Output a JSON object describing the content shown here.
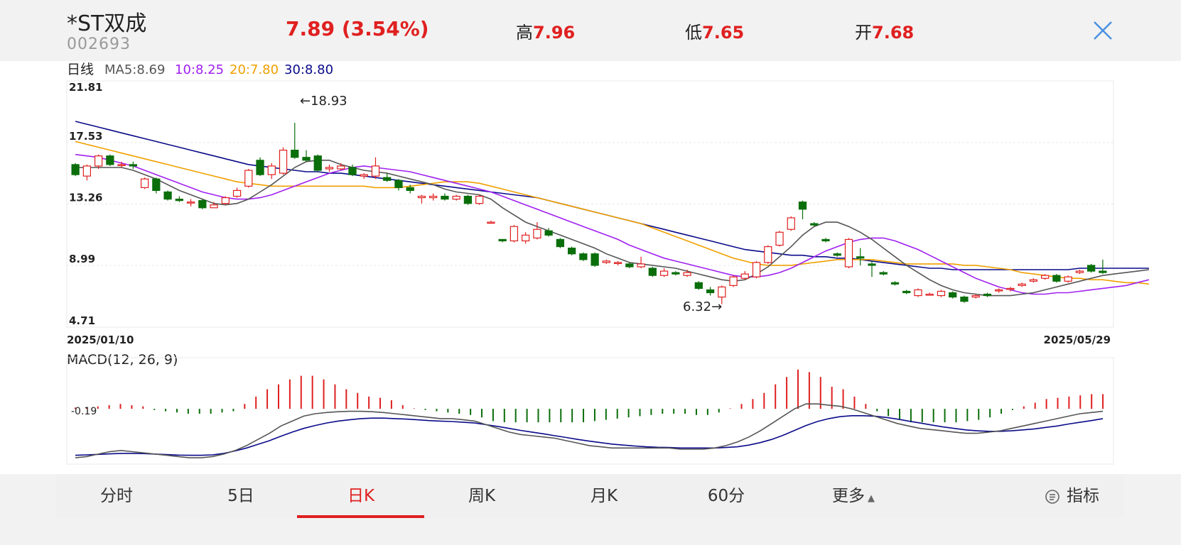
{
  "header": {
    "name": "*ST双成",
    "code": "002693",
    "price": "7.89",
    "change": "(3.54%)",
    "high_label": "高",
    "high": "7.96",
    "low_label": "低",
    "low": "7.65",
    "open_label": "开",
    "open": "7.68"
  },
  "colors": {
    "up": "#e02020",
    "down": "#0a6e0a",
    "ma5": "#555555",
    "ma10": "#a020f0",
    "ma20": "#f0a000",
    "ma30": "#0a0a8a",
    "dif": "#555555",
    "dea": "#0a0a8a"
  },
  "legend": {
    "period": "日线",
    "ma5": "MA5:8.69",
    "ma10": "10:8.25",
    "ma20": "20:7.80",
    "ma30": "30:8.80"
  },
  "tabs": [
    {
      "label": "分时"
    },
    {
      "label": "5日"
    },
    {
      "label": "日K"
    },
    {
      "label": "周K"
    },
    {
      "label": "月K"
    },
    {
      "label": "60分"
    },
    {
      "label": "更多"
    }
  ],
  "indicator_label": "指标",
  "chart_data": {
    "type": "candlestick",
    "start_date": "2025/01/10",
    "end_date": "2025/05/29",
    "y_ticks": [
      "21.81",
      "17.53",
      "13.26",
      "8.99",
      "4.71"
    ],
    "ylim": [
      4.71,
      21.81
    ],
    "max_label": "←18.93",
    "min_label": "6.32→",
    "candles": [
      [
        16.0,
        15.3,
        16.1,
        15.2
      ],
      [
        15.2,
        15.9,
        16.0,
        14.9
      ],
      [
        15.9,
        16.6,
        16.7,
        15.7
      ],
      [
        16.6,
        16.0,
        16.7,
        15.9
      ],
      [
        16.0,
        16.0,
        16.2,
        15.8
      ],
      [
        16.0,
        15.9,
        16.2,
        15.7
      ],
      [
        14.4,
        15.0,
        15.1,
        14.3
      ],
      [
        15.0,
        14.2,
        15.1,
        14.0
      ],
      [
        14.1,
        13.6,
        14.2,
        13.5
      ],
      [
        13.6,
        13.5,
        13.8,
        13.4
      ],
      [
        13.4,
        13.4,
        13.6,
        13.1
      ],
      [
        13.5,
        13.0,
        13.6,
        12.9
      ],
      [
        13.0,
        13.2,
        13.4,
        13.0
      ],
      [
        13.3,
        13.7,
        13.8,
        13.2
      ],
      [
        13.8,
        14.2,
        14.4,
        13.7
      ],
      [
        14.5,
        15.6,
        15.7,
        14.4
      ],
      [
        16.3,
        15.3,
        16.5,
        15.2
      ],
      [
        15.3,
        15.9,
        16.1,
        15.0
      ],
      [
        15.4,
        17.0,
        17.2,
        15.3
      ],
      [
        17.0,
        16.5,
        18.9,
        16.4
      ],
      [
        16.5,
        16.3,
        17.0,
        16.2
      ],
      [
        16.6,
        15.6,
        16.7,
        15.5
      ],
      [
        15.7,
        15.8,
        16.0,
        15.5
      ],
      [
        15.7,
        15.9,
        16.1,
        15.6
      ],
      [
        15.8,
        15.3,
        16.0,
        15.2
      ],
      [
        15.2,
        15.3,
        15.4,
        15.0
      ],
      [
        15.2,
        15.9,
        16.5,
        15.0
      ],
      [
        15.1,
        14.9,
        15.4,
        14.8
      ],
      [
        14.9,
        14.4,
        15.0,
        14.2
      ],
      [
        14.4,
        14.2,
        14.6,
        14.0
      ],
      [
        13.7,
        13.8,
        13.9,
        13.3
      ],
      [
        13.7,
        13.8,
        14.0,
        13.5
      ],
      [
        13.8,
        13.6,
        14.0,
        13.5
      ],
      [
        13.6,
        13.8,
        13.9,
        13.5
      ],
      [
        13.8,
        13.3,
        13.9,
        13.2
      ],
      [
        13.3,
        13.8,
        13.9,
        13.2
      ],
      [
        12.0,
        12.0,
        12.1,
        11.9
      ],
      [
        10.8,
        10.7,
        10.8,
        10.6
      ],
      [
        10.7,
        11.7,
        11.8,
        10.6
      ],
      [
        10.7,
        11.1,
        11.3,
        10.5
      ],
      [
        10.9,
        11.5,
        12.0,
        10.8
      ],
      [
        11.4,
        11.1,
        11.6,
        11.0
      ],
      [
        10.8,
        10.3,
        10.9,
        10.2
      ],
      [
        10.2,
        9.8,
        10.3,
        9.7
      ],
      [
        9.8,
        9.4,
        9.9,
        9.3
      ],
      [
        9.8,
        9.0,
        9.9,
        8.9
      ],
      [
        9.2,
        9.3,
        9.4,
        9.1
      ],
      [
        9.2,
        9.2,
        9.3,
        9.0
      ],
      [
        9.1,
        8.9,
        9.2,
        8.8
      ],
      [
        8.9,
        9.1,
        9.6,
        8.8
      ],
      [
        8.8,
        8.3,
        8.9,
        8.2
      ],
      [
        8.3,
        8.6,
        8.8,
        8.2
      ],
      [
        8.5,
        8.4,
        8.6,
        8.3
      ],
      [
        8.3,
        8.5,
        8.7,
        8.2
      ],
      [
        7.8,
        7.4,
        7.9,
        7.3
      ],
      [
        7.3,
        7.1,
        7.5,
        6.9
      ],
      [
        6.8,
        7.5,
        7.6,
        6.3
      ],
      [
        7.6,
        8.2,
        8.3,
        7.5
      ],
      [
        8.1,
        8.4,
        8.6,
        8.0
      ],
      [
        8.2,
        9.2,
        9.3,
        8.1
      ],
      [
        9.2,
        10.3,
        10.4,
        9.1
      ],
      [
        10.4,
        11.3,
        11.4,
        10.3
      ],
      [
        11.5,
        12.3,
        12.4,
        11.4
      ],
      [
        13.4,
        12.9,
        13.5,
        12.2
      ],
      [
        11.9,
        11.8,
        12.0,
        11.7
      ],
      [
        10.8,
        10.7,
        10.9,
        10.6
      ],
      [
        9.8,
        9.7,
        9.9,
        9.6
      ],
      [
        8.9,
        10.8,
        10.9,
        8.8
      ],
      [
        9.6,
        9.5,
        10.2,
        9.0
      ],
      [
        9.1,
        9.0,
        9.3,
        8.2
      ],
      [
        8.5,
        8.4,
        8.6,
        8.3
      ],
      [
        7.8,
        7.7,
        7.9,
        7.6
      ],
      [
        7.2,
        7.1,
        7.3,
        7.0
      ],
      [
        6.9,
        7.3,
        7.4,
        6.8
      ],
      [
        7.0,
        7.0,
        7.1,
        6.9
      ],
      [
        6.9,
        7.2,
        7.3,
        6.8
      ],
      [
        7.1,
        6.8,
        7.2,
        6.7
      ],
      [
        6.8,
        6.5,
        6.9,
        6.4
      ],
      [
        6.8,
        6.9,
        7.0,
        6.7
      ],
      [
        7.0,
        6.9,
        7.1,
        6.8
      ],
      [
        7.3,
        7.3,
        7.4,
        7.1
      ],
      [
        7.4,
        7.4,
        7.5,
        7.2
      ],
      [
        7.6,
        7.7,
        7.8,
        7.5
      ],
      [
        7.9,
        8.0,
        8.1,
        7.8
      ],
      [
        8.1,
        8.3,
        8.4,
        8.0
      ],
      [
        8.3,
        7.9,
        8.4,
        7.8
      ],
      [
        7.9,
        8.2,
        8.3,
        7.8
      ],
      [
        8.5,
        8.6,
        8.7,
        8.4
      ],
      [
        9.0,
        8.6,
        9.1,
        8.5
      ],
      [
        8.6,
        8.5,
        9.4,
        8.4
      ]
    ],
    "ma5": [
      15.8,
      15.8,
      15.8,
      15.8,
      15.8,
      15.6,
      15.3,
      15.0,
      14.6,
      14.2,
      13.9,
      13.6,
      13.3,
      13.2,
      13.3,
      13.6,
      14.1,
      14.6,
      15.2,
      15.8,
      16.2,
      16.3,
      16.3,
      16.0,
      15.8,
      15.6,
      15.5,
      15.4,
      15.2,
      15.0,
      14.8,
      14.6,
      14.3,
      14.1,
      14.0,
      13.9,
      13.6,
      13.0,
      12.5,
      12.0,
      11.7,
      11.4,
      11.1,
      10.8,
      10.5,
      10.2,
      9.8,
      9.5,
      9.2,
      9.1,
      9.0,
      8.9,
      8.8,
      8.6,
      8.4,
      8.2,
      8.0,
      7.9,
      8.0,
      8.4,
      8.9,
      9.6,
      10.3,
      11.1,
      11.7,
      12.0,
      12.0,
      11.7,
      11.3,
      10.8,
      10.2,
      9.6,
      9.0,
      8.5,
      8.0,
      7.6,
      7.3,
      7.1,
      7.0,
      6.9,
      6.9,
      6.9,
      7.0,
      7.1,
      7.3,
      7.5,
      7.7,
      7.9,
      8.1,
      8.3,
      8.4,
      8.5,
      8.6,
      8.7
    ],
    "ma10": [
      16.7,
      16.6,
      16.5,
      16.3,
      16.1,
      15.9,
      15.6,
      15.3,
      15.0,
      14.7,
      14.4,
      14.1,
      13.9,
      13.7,
      13.6,
      13.6,
      13.7,
      13.9,
      14.2,
      14.5,
      14.8,
      15.1,
      15.4,
      15.6,
      15.8,
      15.9,
      15.8,
      15.7,
      15.6,
      15.5,
      15.3,
      15.1,
      14.9,
      14.7,
      14.5,
      14.3,
      14.1,
      13.8,
      13.5,
      13.2,
      12.9,
      12.6,
      12.3,
      12.0,
      11.7,
      11.4,
      11.1,
      10.8,
      10.4,
      10.1,
      9.8,
      9.5,
      9.3,
      9.1,
      8.9,
      8.7,
      8.5,
      8.3,
      8.2,
      8.2,
      8.3,
      8.5,
      8.8,
      9.2,
      9.6,
      10.0,
      10.3,
      10.6,
      10.8,
      10.9,
      10.9,
      10.7,
      10.4,
      10.1,
      9.7,
      9.3,
      8.9,
      8.5,
      8.1,
      7.8,
      7.5,
      7.3,
      7.1,
      7.0,
      7.0,
      7.1,
      7.1,
      7.2,
      7.3,
      7.4,
      7.5,
      7.6,
      7.8,
      8.0
    ],
    "ma20": [
      17.6,
      17.4,
      17.2,
      17.0,
      16.8,
      16.6,
      16.4,
      16.2,
      16.0,
      15.8,
      15.6,
      15.4,
      15.2,
      15.0,
      14.8,
      14.7,
      14.6,
      14.5,
      14.5,
      14.5,
      14.5,
      14.5,
      14.5,
      14.5,
      14.5,
      14.5,
      14.4,
      14.4,
      14.4,
      14.5,
      14.6,
      14.7,
      14.8,
      14.8,
      14.8,
      14.7,
      14.5,
      14.3,
      14.1,
      13.9,
      13.7,
      13.5,
      13.3,
      13.1,
      12.9,
      12.7,
      12.5,
      12.3,
      12.1,
      11.9,
      11.6,
      11.3,
      11.0,
      10.7,
      10.4,
      10.1,
      9.8,
      9.5,
      9.3,
      9.1,
      9.0,
      9.0,
      9.0,
      9.1,
      9.2,
      9.3,
      9.4,
      9.4,
      9.4,
      9.4,
      9.3,
      9.2,
      9.1,
      9.1,
      9.1,
      9.1,
      9.1,
      9.0,
      9.0,
      8.9,
      8.8,
      8.7,
      8.5,
      8.4,
      8.3,
      8.2,
      8.1,
      8.1,
      8.0,
      8.0,
      7.9,
      7.8,
      7.8,
      7.7
    ],
    "ma30": [
      19.0,
      18.8,
      18.6,
      18.4,
      18.2,
      18.0,
      17.8,
      17.6,
      17.4,
      17.2,
      17.0,
      16.8,
      16.6,
      16.4,
      16.2,
      16.0,
      15.9,
      15.8,
      15.7,
      15.6,
      15.5,
      15.5,
      15.4,
      15.4,
      15.3,
      15.2,
      15.1,
      15.0,
      14.9,
      14.8,
      14.7,
      14.6,
      14.5,
      14.4,
      14.3,
      14.2,
      14.1,
      14.0,
      13.9,
      13.8,
      13.7,
      13.5,
      13.3,
      13.1,
      12.9,
      12.7,
      12.5,
      12.3,
      12.1,
      11.9,
      11.7,
      11.5,
      11.3,
      11.1,
      10.9,
      10.7,
      10.5,
      10.3,
      10.1,
      10.0,
      9.9,
      9.8,
      9.7,
      9.7,
      9.6,
      9.6,
      9.5,
      9.5,
      9.4,
      9.3,
      9.2,
      9.1,
      9.0,
      8.9,
      8.8,
      8.8,
      8.7,
      8.7,
      8.7,
      8.7,
      8.7,
      8.7,
      8.7,
      8.7,
      8.7,
      8.7,
      8.7,
      8.8,
      8.8,
      8.8,
      8.8,
      8.8,
      8.8,
      8.8
    ],
    "macd": {
      "label": "MACD(12, 26, 9)",
      "zero_label": "-0.19",
      "ylim": [
        -2.2,
        1.8
      ],
      "bars": [
        0.05,
        0.05,
        0.1,
        0.15,
        0.2,
        0.15,
        0.1,
        -0.05,
        -0.1,
        -0.15,
        -0.2,
        -0.2,
        -0.2,
        -0.15,
        -0.1,
        0.2,
        0.5,
        0.8,
        1.0,
        1.2,
        1.35,
        1.35,
        1.2,
        1.0,
        0.8,
        0.65,
        0.5,
        0.45,
        0.35,
        0.15,
        0.02,
        -0.05,
        -0.1,
        -0.15,
        -0.2,
        -0.25,
        -0.35,
        -0.5,
        -0.55,
        -0.55,
        -0.55,
        -0.55,
        -0.55,
        -0.55,
        -0.55,
        -0.55,
        -0.5,
        -0.45,
        -0.4,
        -0.35,
        -0.3,
        -0.25,
        -0.2,
        -0.2,
        -0.2,
        -0.25,
        -0.25,
        -0.15,
        0.02,
        0.2,
        0.4,
        0.65,
        1.0,
        1.3,
        1.6,
        1.5,
        1.3,
        0.9,
        0.8,
        0.5,
        0.2,
        -0.1,
        -0.3,
        -0.45,
        -0.55,
        -0.55,
        -0.55,
        -0.55,
        -0.55,
        -0.5,
        -0.45,
        -0.35,
        -0.2,
        -0.05,
        0.1,
        0.25,
        0.4,
        0.45,
        0.5,
        0.55,
        0.6,
        0.6
      ],
      "dif": [
        -2.0,
        -1.95,
        -1.85,
        -1.75,
        -1.7,
        -1.75,
        -1.8,
        -1.85,
        -1.9,
        -1.95,
        -2.0,
        -2.0,
        -1.95,
        -1.85,
        -1.7,
        -1.5,
        -1.25,
        -1.0,
        -0.7,
        -0.5,
        -0.3,
        -0.2,
        -0.15,
        -0.12,
        -0.1,
        -0.1,
        -0.12,
        -0.15,
        -0.2,
        -0.25,
        -0.3,
        -0.35,
        -0.4,
        -0.4,
        -0.45,
        -0.5,
        -0.65,
        -0.8,
        -0.95,
        -1.05,
        -1.1,
        -1.15,
        -1.2,
        -1.3,
        -1.4,
        -1.5,
        -1.55,
        -1.6,
        -1.6,
        -1.6,
        -1.6,
        -1.6,
        -1.6,
        -1.65,
        -1.65,
        -1.65,
        -1.6,
        -1.5,
        -1.35,
        -1.15,
        -0.9,
        -0.6,
        -0.3,
        0.0,
        0.2,
        0.2,
        0.15,
        0.1,
        0.0,
        -0.15,
        -0.3,
        -0.45,
        -0.6,
        -0.7,
        -0.8,
        -0.85,
        -0.9,
        -0.95,
        -1.0,
        -1.0,
        -0.95,
        -0.9,
        -0.8,
        -0.7,
        -0.6,
        -0.5,
        -0.4,
        -0.3,
        -0.2,
        -0.15,
        -0.1
      ],
      "dea": [
        -1.9,
        -1.88,
        -1.86,
        -1.84,
        -1.82,
        -1.82,
        -1.83,
        -1.85,
        -1.87,
        -1.89,
        -1.9,
        -1.9,
        -1.88,
        -1.82,
        -1.72,
        -1.6,
        -1.45,
        -1.3,
        -1.12,
        -0.95,
        -0.8,
        -0.68,
        -0.58,
        -0.5,
        -0.45,
        -0.4,
        -0.38,
        -0.38,
        -0.4,
        -0.42,
        -0.45,
        -0.48,
        -0.5,
        -0.52,
        -0.55,
        -0.58,
        -0.65,
        -0.72,
        -0.8,
        -0.88,
        -0.95,
        -1.02,
        -1.1,
        -1.17,
        -1.25,
        -1.32,
        -1.38,
        -1.44,
        -1.48,
        -1.52,
        -1.55,
        -1.57,
        -1.58,
        -1.6,
        -1.6,
        -1.6,
        -1.6,
        -1.58,
        -1.55,
        -1.48,
        -1.38,
        -1.25,
        -1.08,
        -0.88,
        -0.68,
        -0.52,
        -0.4,
        -0.32,
        -0.28,
        -0.28,
        -0.3,
        -0.35,
        -0.42,
        -0.5,
        -0.58,
        -0.66,
        -0.74,
        -0.8,
        -0.86,
        -0.9,
        -0.92,
        -0.92,
        -0.9,
        -0.86,
        -0.82,
        -0.76,
        -0.7,
        -0.62,
        -0.55,
        -0.48,
        -0.4
      ]
    }
  }
}
